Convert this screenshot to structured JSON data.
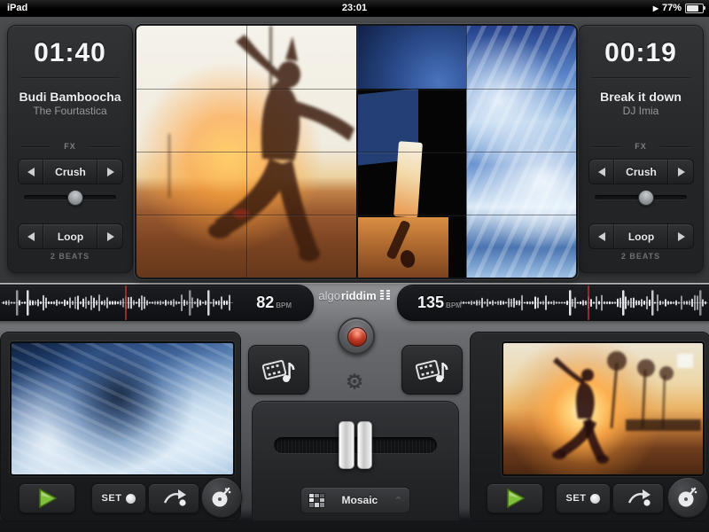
{
  "status_bar": {
    "carrier": "iPad",
    "time": "23:01",
    "play_glyph": "▶",
    "battery_percent": "77%"
  },
  "deck_left": {
    "elapsed": "01:40",
    "title": "Budi Bamboocha",
    "artist": "The Fourtastica",
    "fx_label": "FX",
    "fx_value": "Crush",
    "loop_value": "Loop",
    "loop_info": "2 BEATS",
    "bpm": "82",
    "bpm_unit": "BPM"
  },
  "deck_right": {
    "elapsed": "00:19",
    "title": "Break it down",
    "artist": "DJ Imia",
    "fx_label": "FX",
    "fx_value": "Crush",
    "loop_value": "Loop",
    "loop_info": "2 BEATS",
    "bpm": "135",
    "bpm_unit": "BPM"
  },
  "logo": {
    "light": "algo",
    "bold": "riddim"
  },
  "center_console": {
    "mosaic_label": "Mosaic",
    "chevron_glyph": "⌃"
  },
  "icons": {
    "gear_glyph": "⚙"
  },
  "transport": {
    "set_label": "SET"
  },
  "colors": {
    "accent_green": "#7fc13d",
    "record_red": "#c03a26",
    "playhead_red": "#a33232"
  }
}
